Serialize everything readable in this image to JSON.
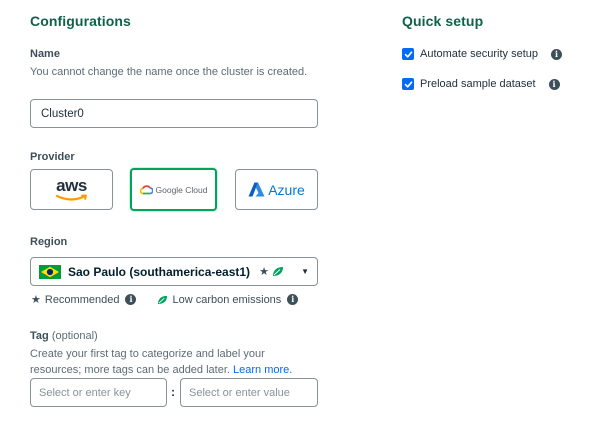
{
  "configurations": {
    "title": "Configurations",
    "name": {
      "label": "Name",
      "description": "You cannot change the name once the cluster is created.",
      "value": "Cluster0"
    },
    "provider": {
      "label": "Provider",
      "options": [
        {
          "label": "aws",
          "icon": "aws-logo"
        },
        {
          "label": "Google Cloud",
          "icon": "google-cloud-logo"
        },
        {
          "label": "Azure",
          "icon": "azure-logo"
        }
      ],
      "selected": "Google Cloud"
    },
    "region": {
      "label": "Region",
      "selected": "Sao Paulo (southamerica-east1)",
      "flag": "brazil-flag",
      "legend": {
        "recommended": "Recommended",
        "low_carbon": "Low carbon emissions"
      }
    },
    "tag": {
      "label": "Tag",
      "optional": "(optional)",
      "description": "Create your first tag to categorize and label your resources; more tags can be added later.",
      "learn_more": "Learn more.",
      "key_placeholder": "Select or enter key",
      "separator": ":",
      "value_placeholder": "Select or enter value"
    }
  },
  "quick_setup": {
    "title": "Quick setup",
    "options": [
      {
        "label": "Automate security setup",
        "checked": true
      },
      {
        "label": "Preload sample dataset",
        "checked": true
      }
    ]
  },
  "colors": {
    "heading_green": "#116149",
    "selected_border": "#00a35c",
    "checkbox_blue": "#016bf8",
    "link_blue": "#016bf8"
  }
}
